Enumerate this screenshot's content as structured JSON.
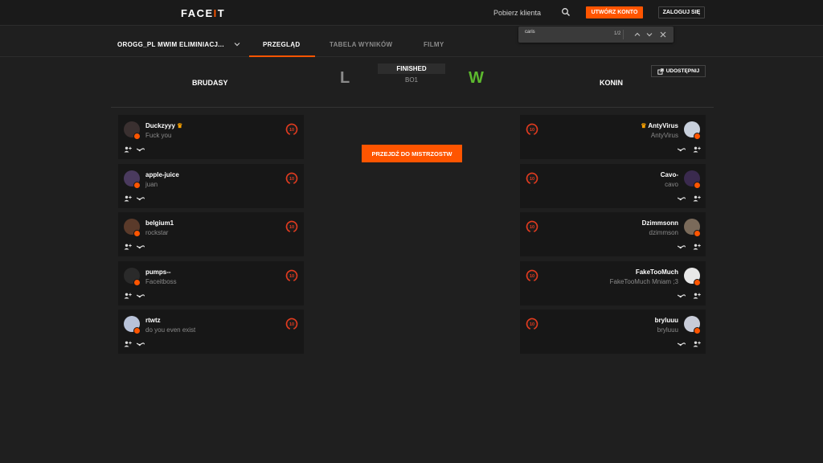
{
  "header": {
    "logo_main": "FACE",
    "logo_accent": "I",
    "logo_end": "T",
    "download_link": "Pobierz klienta",
    "create_button": "UTWÓRZ KONTO",
    "login_button": "ZALOGUJ SIĘ"
  },
  "find": {
    "query": "caris",
    "count": "1/2"
  },
  "nav": {
    "tournament": "OROGG_PL MWIM ELIMINIACJ...",
    "tabs": [
      "PRZEGLĄD",
      "TABELA WYNIKÓW",
      "FILMY"
    ],
    "active_tab": "PRZEGLĄD"
  },
  "match": {
    "team_left": "BRUDASY",
    "team_right": "KONIN",
    "result_left": "L",
    "result_right": "W",
    "status": "FINISHED",
    "format": "BO1",
    "share_button": "UDOSTĘPNIJ",
    "cta_button": "PRZEJDŹ DO MISTRZOSTW",
    "result_colors": {
      "win": "#5cb82e",
      "loss": "#8a8a8a"
    },
    "accent": "#ff5500"
  },
  "players_left": [
    {
      "name": "Duckzyyy",
      "desc": "Fuck you",
      "crown": true,
      "level": "10"
    },
    {
      "name": "apple-juice",
      "desc": "juan",
      "crown": false,
      "level": "10"
    },
    {
      "name": "belgium1",
      "desc": "rockstar",
      "crown": false,
      "level": "10"
    },
    {
      "name": "pumps--",
      "desc": "Faceitboss",
      "crown": false,
      "level": "10"
    },
    {
      "name": "rtwtz",
      "desc": "do you even exist",
      "crown": false,
      "level": "10"
    }
  ],
  "players_right": [
    {
      "name": "AntyVirus",
      "desc": "AntyVirus",
      "crown": true,
      "level": "10"
    },
    {
      "name": "Cavo-",
      "desc": "cavo",
      "crown": false,
      "level": "10"
    },
    {
      "name": "Dzimmsonn",
      "desc": "dzimmson",
      "crown": false,
      "level": "10"
    },
    {
      "name": "FakeTooMuch",
      "desc": "FakeTooMuch Mniam ;3",
      "crown": false,
      "level": "10"
    },
    {
      "name": "bryluuu",
      "desc": "bryluuu",
      "crown": false,
      "level": "10"
    }
  ],
  "icons": {
    "search": "search-icon",
    "chevron": "chevron-down-icon",
    "share": "share-icon",
    "add_friend": "add-friend-icon",
    "steam": "steam-icon",
    "level": "skill-level-icon"
  }
}
